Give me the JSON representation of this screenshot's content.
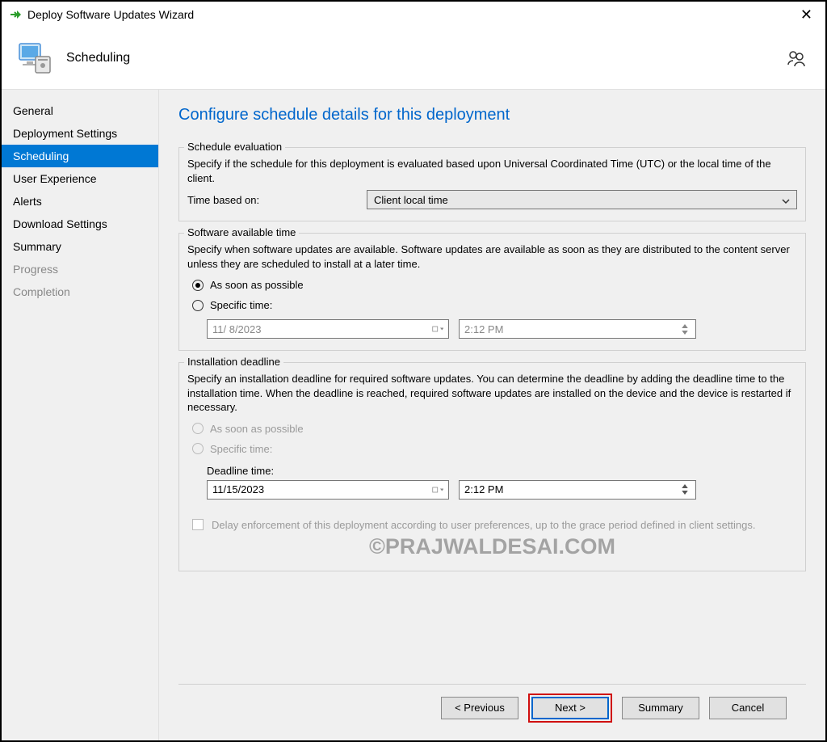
{
  "window": {
    "title": "Deploy Software Updates Wizard"
  },
  "header": {
    "step_title": "Scheduling"
  },
  "sidebar": {
    "items": [
      {
        "label": "General"
      },
      {
        "label": "Deployment Settings"
      },
      {
        "label": "Scheduling"
      },
      {
        "label": "User Experience"
      },
      {
        "label": "Alerts"
      },
      {
        "label": "Download Settings"
      },
      {
        "label": "Summary"
      },
      {
        "label": "Progress"
      },
      {
        "label": "Completion"
      }
    ]
  },
  "content": {
    "title": "Configure schedule details for this deployment",
    "schedule_eval": {
      "legend": "Schedule evaluation",
      "desc": "Specify if the schedule for this deployment is evaluated based upon Universal Coordinated Time (UTC) or the local time of the client.",
      "time_based_label": "Time based on:",
      "time_based_value": "Client local time"
    },
    "available_time": {
      "legend": "Software available time",
      "desc": "Specify when software updates are available. Software updates are available as soon as they are distributed to the content server unless they are scheduled to install at a later time.",
      "asap": "As soon as possible",
      "specific": "Specific time:",
      "date": "11/ 8/2023",
      "time": "2:12 PM"
    },
    "deadline": {
      "legend": "Installation deadline",
      "desc": "Specify an installation deadline for required software updates. You can determine the deadline by adding the deadline time to the installation time. When the deadline is reached, required software updates are installed on the device and the device is restarted if necessary.",
      "asap": "As soon as possible",
      "specific": "Specific time:",
      "deadline_label": "Deadline time:",
      "date": "11/15/2023",
      "time": "2:12 PM",
      "delay_checkbox": "Delay enforcement of this deployment according to user preferences, up to the grace period defined in client settings."
    },
    "watermark": "©PRAJWALDESAI.COM"
  },
  "buttons": {
    "previous": "< Previous",
    "next": "Next >",
    "summary": "Summary",
    "cancel": "Cancel"
  }
}
